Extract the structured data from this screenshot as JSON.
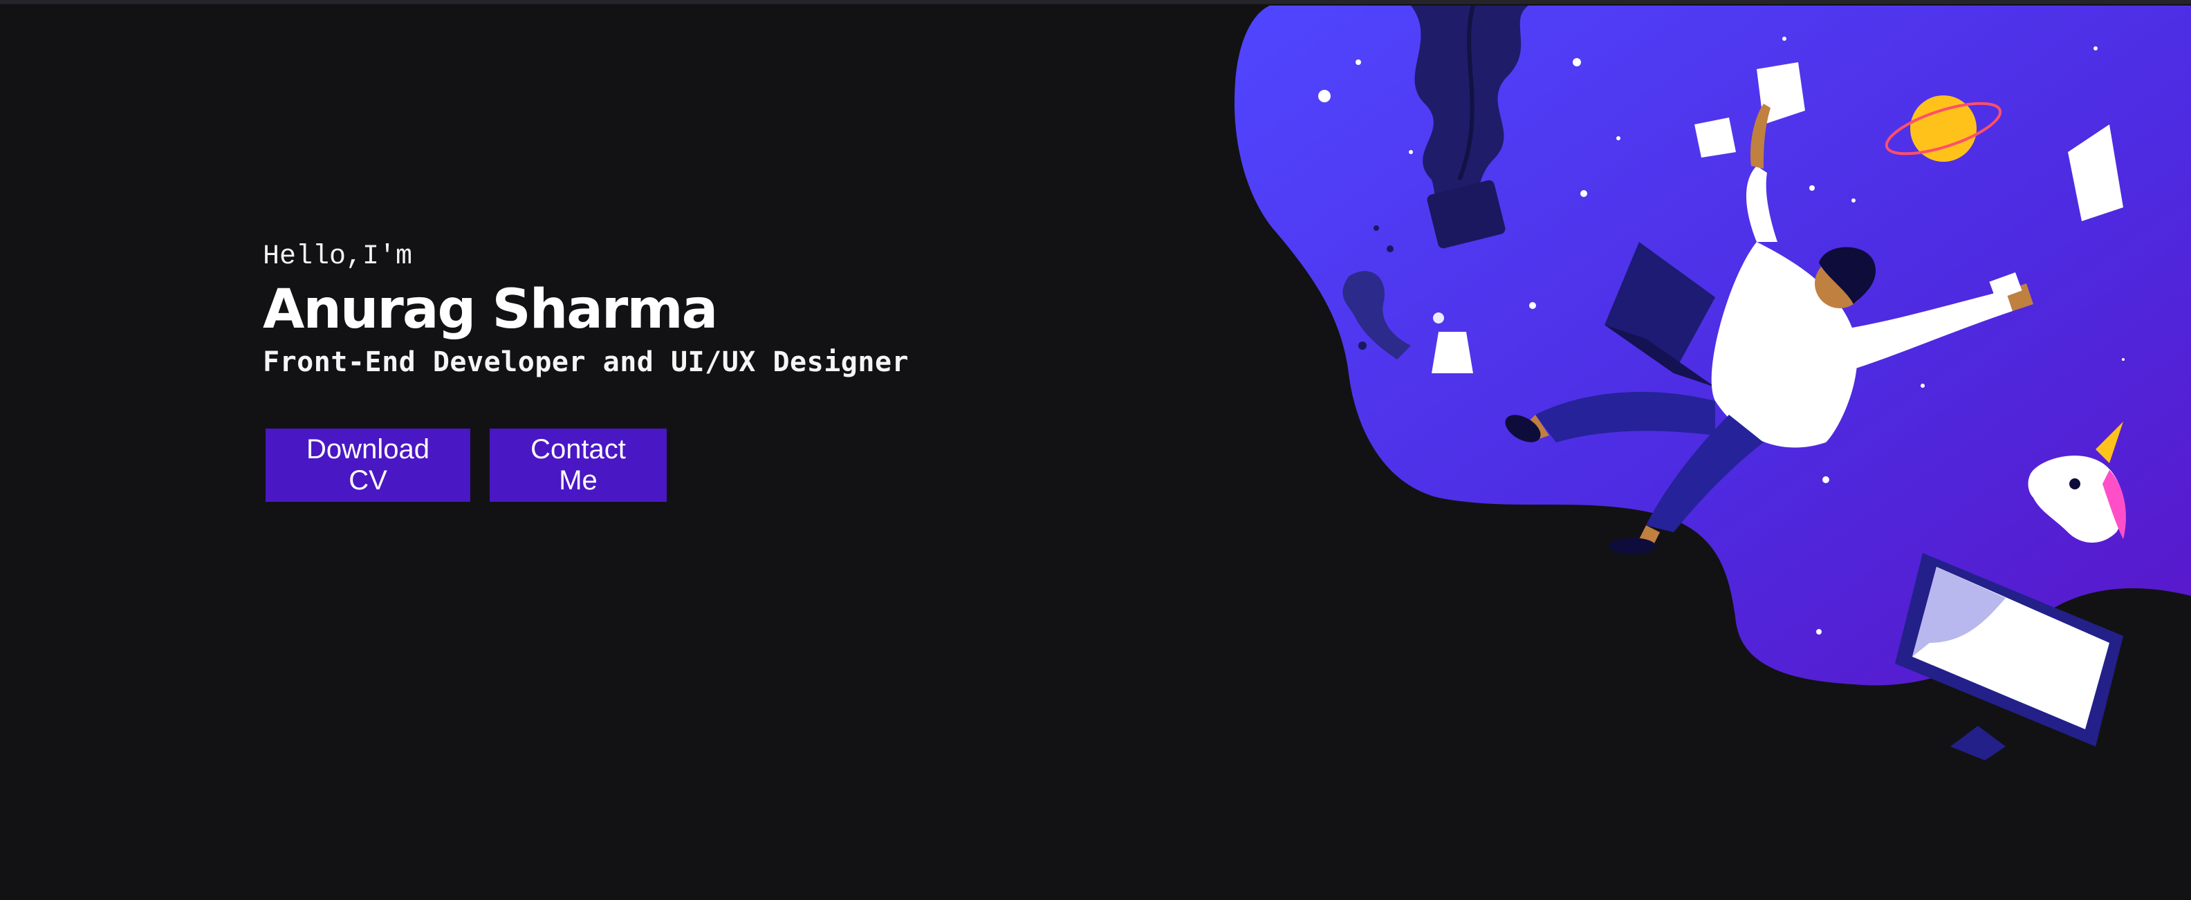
{
  "hero": {
    "greeting": "Hello,I'm",
    "name": "Anurag Sharma",
    "role": "Front-End Developer and UI/UX Designer"
  },
  "buttons": {
    "download_cv": "Download CV",
    "contact_me": "Contact Me"
  },
  "colors": {
    "background": "#121214",
    "accent": "#4a17c4",
    "blob_start": "#5046ff",
    "blob_end": "#5a16c8"
  },
  "illustration": {
    "subject": "person floating in space with laptop, monitor, unicorn, planet, plant"
  }
}
